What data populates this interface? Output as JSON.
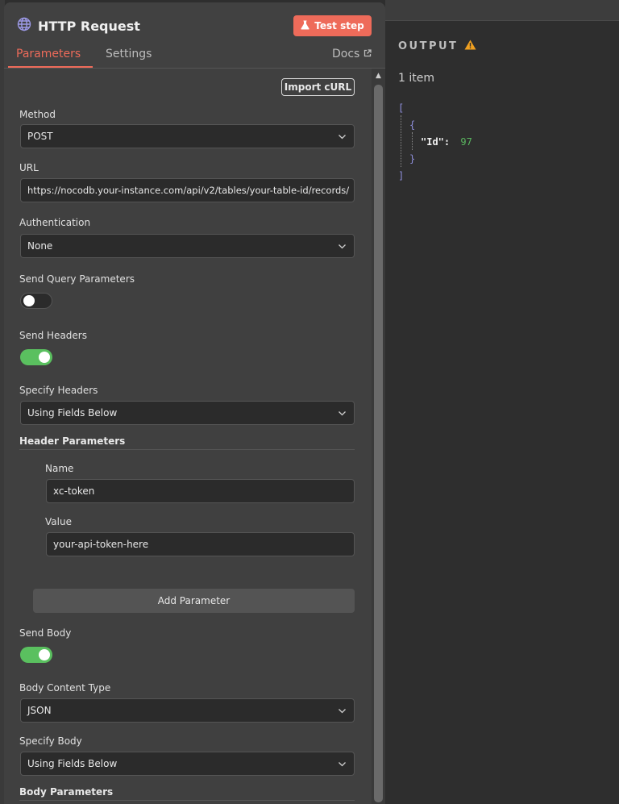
{
  "node": {
    "title": "HTTP Request",
    "test_label": "Test step",
    "tabs": [
      "Parameters",
      "Settings"
    ],
    "docs_label": "Docs"
  },
  "params": {
    "import_label": "Import cURL",
    "method": {
      "label": "Method",
      "value": "POST"
    },
    "url": {
      "label": "URL",
      "value": "https://nocodb.your-instance.com/api/v2/tables/your-table-id/records/"
    },
    "authentication": {
      "label": "Authentication",
      "value": "None"
    },
    "send_query": {
      "label": "Send Query Parameters",
      "enabled": false
    },
    "send_headers": {
      "label": "Send Headers",
      "enabled": true
    },
    "specify_headers": {
      "label": "Specify Headers",
      "value": "Using Fields Below"
    },
    "header_parameters": {
      "label": "Header Parameters",
      "name_label": "Name",
      "name_value": "xc-token",
      "value_label": "Value",
      "value_value": "your-api-token-here",
      "add_label": "Add Parameter"
    },
    "send_body": {
      "label": "Send Body",
      "enabled": true
    },
    "body_content_type": {
      "label": "Body Content Type",
      "value": "JSON"
    },
    "specify_body": {
      "label": "Specify Body",
      "value": "Using Fields Below"
    },
    "body_parameters": {
      "label": "Body Parameters"
    }
  },
  "output": {
    "title": "OUTPUT",
    "item_count": "1 item",
    "json": {
      "open_array": "[",
      "open_object": "{",
      "key": "\"Id\"",
      "colon": ":",
      "value": "97",
      "close_object": "}",
      "close_array": "]"
    }
  },
  "colors": {
    "accent": "#ee6b5a",
    "toggle_on": "#5ac05f",
    "warning": "#f0a020",
    "json_bracket": "#8f8fdc",
    "json_number": "#5ab65f"
  },
  "icons": [
    "globe-icon",
    "flask-icon",
    "external-link-icon",
    "chevron-down-icon",
    "warning-icon",
    "scroll-up-icon"
  ]
}
